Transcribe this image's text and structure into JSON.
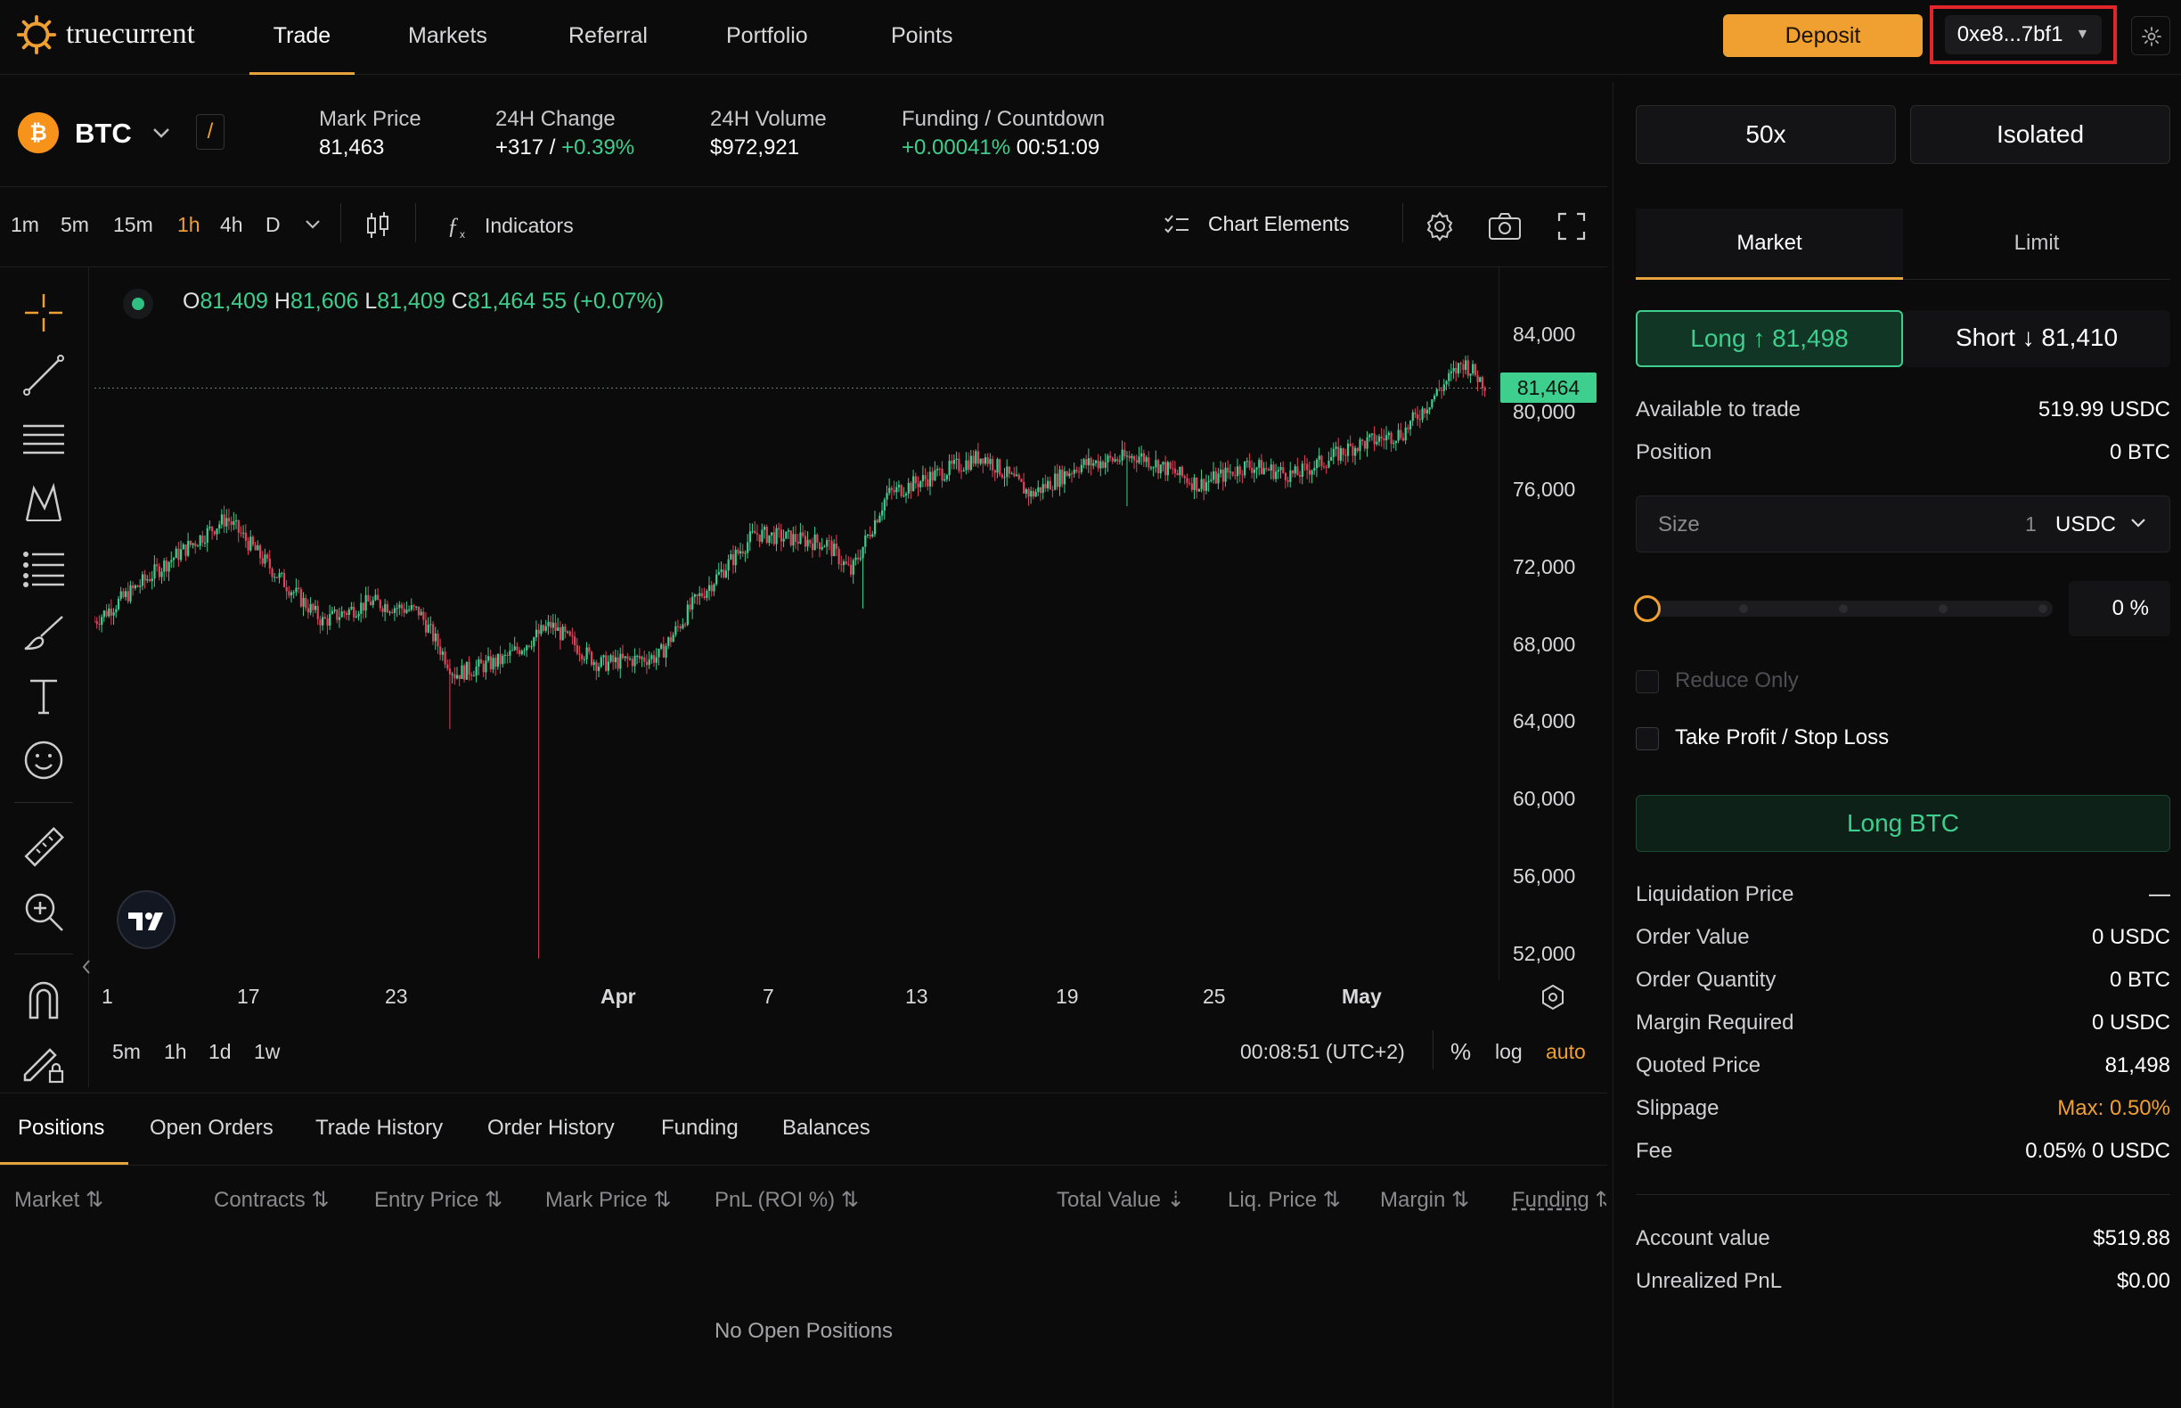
{
  "brand": {
    "name": "truecurrent"
  },
  "nav": {
    "items": [
      "Trade",
      "Markets",
      "Referral",
      "Portfolio",
      "Points"
    ],
    "active": "Trade"
  },
  "account": {
    "deposit_label": "Deposit",
    "wallet": "0xe8...7bf1"
  },
  "ticker": {
    "symbol": "BTC",
    "separator": "/",
    "mark_price_label": "Mark Price",
    "mark_price": "81,463",
    "change_label": "24H Change",
    "change_abs": "+317 /",
    "change_pct": "+0.39%",
    "volume_label": "24H Volume",
    "volume": "$972,921",
    "funding_label": "Funding / Countdown",
    "funding_rate": "+0.00041%",
    "funding_countdown": "00:51:09"
  },
  "toolbar": {
    "timeframes": [
      "1m",
      "5m",
      "15m",
      "1h",
      "4h",
      "D"
    ],
    "active_timeframe": "1h",
    "indicators_label": "Indicators",
    "chart_elements_label": "Chart Elements"
  },
  "ohlc": {
    "o_label": "O",
    "o": "81,409",
    "h_label": "H",
    "h": "81,606",
    "l_label": "L",
    "l": "81,409",
    "c_label": "C",
    "c": "81,464",
    "change": "55 (+0.07%)"
  },
  "chart": {
    "price_ticks": [
      "84,000",
      "80,000",
      "76,000",
      "72,000",
      "68,000",
      "64,000",
      "60,000",
      "56,000",
      "52,000"
    ],
    "date_ticks": [
      "1",
      "17",
      "23",
      "Apr",
      "7",
      "13",
      "19",
      "25",
      "May"
    ],
    "last_price": "81,464",
    "ranges": [
      "5m",
      "1h",
      "1d",
      "1w"
    ],
    "time": "00:08:51 (UTC+2)",
    "percent_label": "%",
    "log_label": "log",
    "auto_label": "auto"
  },
  "positions": {
    "tabs": [
      "Positions",
      "Open Orders",
      "Trade History",
      "Order History",
      "Funding",
      "Balances"
    ],
    "active_tab": "Positions",
    "columns": [
      "Market",
      "Contracts",
      "Entry Price",
      "Mark Price",
      "PnL (ROI %)",
      "Total Value",
      "Liq. Price",
      "Margin",
      "Funding"
    ],
    "empty_text": "No Open Positions"
  },
  "order_panel": {
    "leverage": "50x",
    "margin_mode": "Isolated",
    "tabs": [
      "Market",
      "Limit"
    ],
    "active_tab": "Market",
    "long_label": "Long ↑ 81,498",
    "short_label": "Short ↓ 81,410",
    "available_label": "Available to trade",
    "available_value": "519.99 USDC",
    "position_label": "Position",
    "position_value": "0 BTC",
    "size_label": "Size",
    "size_value": "1",
    "size_unit": "USDC",
    "slider_percent": "0 %",
    "slider_fraction": 0,
    "reduce_only_label": "Reduce Only",
    "tpsl_label": "Take Profit / Stop Loss",
    "submit_label": "Long BTC",
    "details": [
      {
        "label": "Liquidation Price",
        "value": "—"
      },
      {
        "label": "Order Value",
        "value": "0 USDC"
      },
      {
        "label": "Order Quantity",
        "value": "0 BTC"
      },
      {
        "label": "Margin Required",
        "value": "0 USDC"
      },
      {
        "label": "Quoted Price",
        "value": "81,498"
      },
      {
        "label": "Slippage",
        "value": "Max: 0.50%"
      },
      {
        "label": "Fee",
        "value": "0.05% 0 USDC"
      }
    ],
    "account_value_label": "Account value",
    "account_value": "$519.88",
    "unrealized_label": "Unrealized PnL",
    "unrealized_value": "$0.00"
  },
  "colors": {
    "accent": "#f0a030",
    "up": "#3ecf8e",
    "down": "#e0435a",
    "wallet_highlight": "#e0262b"
  }
}
